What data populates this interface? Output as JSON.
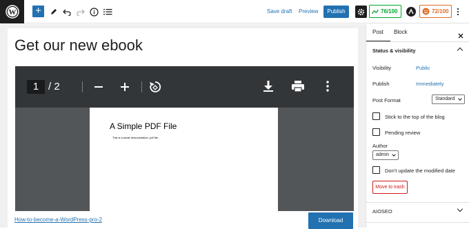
{
  "toolbar": {
    "save_draft": "Save draft",
    "preview": "Preview",
    "publish": "Publish",
    "add_icon": "plus-icon",
    "tools_icon": "pencil-icon",
    "undo_icon": "undo-icon",
    "redo_icon": "redo-icon",
    "details_icon": "info-icon",
    "outline_icon": "list-view-icon",
    "seo_score": "76/100",
    "readability_score": "72/100",
    "seo_score_color": "#00a32a",
    "readability_score_color": "#dd6b20",
    "accent": "#2271b1"
  },
  "editor": {
    "title": "Get our new ebook",
    "pdf": {
      "page_current": "1",
      "page_total": "/ 2",
      "page_heading": "A Simple PDF File",
      "page_body": "This is a small demonstration .pdf file -"
    },
    "download_link": "How-to-become-a-WordPress-pro-2",
    "download_button": "Download"
  },
  "sidebar": {
    "tabs": [
      "Post",
      "Block"
    ],
    "section_title": "Status & visibility",
    "visibility_label": "Visibility",
    "visibility_value": "Public",
    "publish_label": "Publish",
    "publish_value": "Immediately",
    "post_format_label": "Post Format",
    "post_format_value": "Standard",
    "stick_to_top": "Stick to the top of the blog",
    "pending_review": "Pending review",
    "author_label": "Author",
    "author_value": "admin",
    "dont_update_modified": "Don't update the modified date",
    "move_to_trash": "Move to trash",
    "aioseo": "AIOSEO"
  }
}
